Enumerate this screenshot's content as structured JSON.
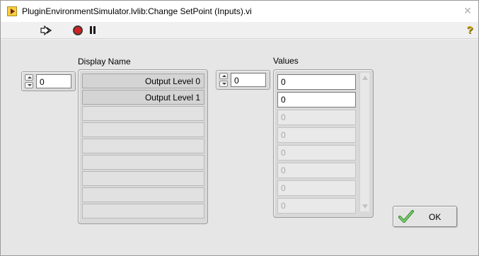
{
  "window": {
    "title": "PluginEnvironmentSimulator.lvlib:Change SetPoint (Inputs).vi",
    "close_glyph": "✕"
  },
  "toolbar": {
    "run_icon": "run-continuously-icon",
    "stop_icon": "abort-icon",
    "pause_icon": "pause-icon",
    "help_glyph": "?"
  },
  "display_name": {
    "label": "Display Name",
    "index": "0",
    "items": [
      "Output Level 0",
      "Output Level 1",
      "",
      "",
      "",
      "",
      "",
      "",
      ""
    ]
  },
  "values": {
    "label": "Values",
    "index": "0",
    "items": [
      "0",
      "0",
      "0",
      "0",
      "0",
      "0",
      "0",
      "0"
    ],
    "active_count": 2
  },
  "ok_button": {
    "label": "OK",
    "icon": "checkmark-icon"
  },
  "colors": {
    "panel": "#e6e6e6",
    "stop": "#d32020",
    "help": "#c9a400",
    "check": "#3aa635"
  }
}
